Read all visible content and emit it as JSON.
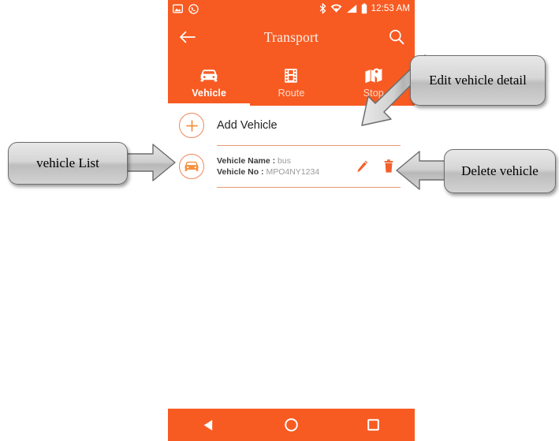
{
  "status_bar": {
    "icons_left": [
      "image-icon",
      "whatsapp-icon"
    ],
    "icons_right": [
      "bluetooth-icon",
      "wifi-icon",
      "signal-icon",
      "battery-icon"
    ],
    "time": "12:53 AM"
  },
  "app_bar": {
    "back_icon": "back-arrow-icon",
    "title": "Transport",
    "search_icon": "search-icon"
  },
  "tabs": [
    {
      "label": "Vehicle",
      "icon": "car-icon",
      "active": true
    },
    {
      "label": "Route",
      "icon": "film-strip-icon",
      "active": false
    },
    {
      "label": "Stop",
      "icon": "map-pin-icon",
      "active": false
    }
  ],
  "content": {
    "add_vehicle": {
      "icon": "plus-circle-icon",
      "label": "Add Vehicle"
    },
    "vehicle_item": {
      "icon": "car-circle-icon",
      "name_label": "Vehicle Name :",
      "name_value": "bus",
      "number_label": "Vehicle No :",
      "number_value": "MPO4NY1234",
      "edit_icon": "pencil-icon",
      "delete_icon": "trash-icon"
    }
  },
  "nav_bar": {
    "back": "triangle-back-icon",
    "home": "circle-home-icon",
    "recents": "square-recents-icon"
  },
  "annotations": [
    {
      "id": "vehicle-list",
      "text": "vehicle List",
      "arrow": "right"
    },
    {
      "id": "edit-vehicle",
      "text": "Edit  vehicle detail",
      "arrow": "down-left-diagonal"
    },
    {
      "id": "delete-vehicle",
      "text": "Delete vehicle",
      "arrow": "left"
    }
  ],
  "colors": {
    "accent_orange": "#F75B22",
    "divider_orange": "#E79A74",
    "callout_gray": "#d2d2d2",
    "tab_inactive_text": "#fcdbcd"
  }
}
